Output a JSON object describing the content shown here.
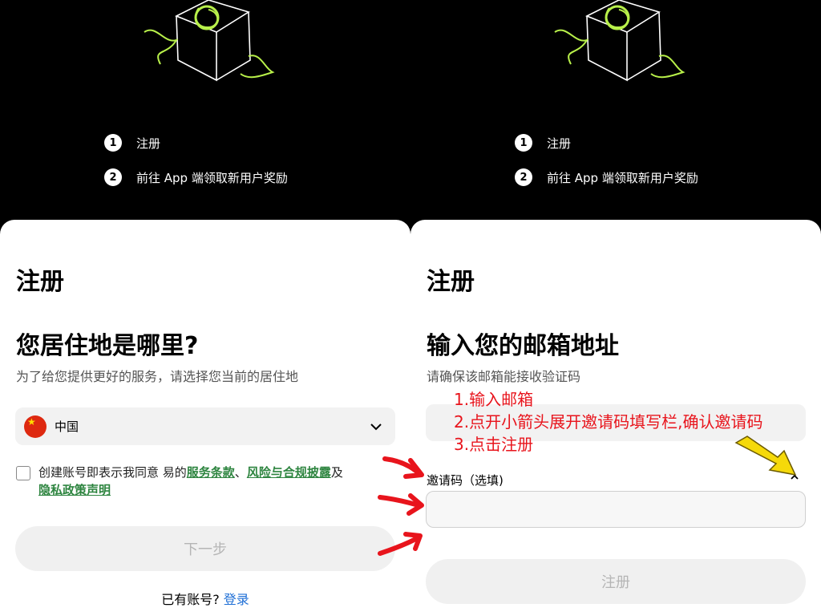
{
  "steps": [
    {
      "num": "1",
      "label": "注册"
    },
    {
      "num": "2",
      "label": "前往 App 端领取新用户奖励"
    }
  ],
  "left": {
    "title": "注册",
    "heading": "您居住地是哪里?",
    "subtitle": "为了给您提供更好的服务，请选择您当前的居住地",
    "country": "中国",
    "agree_prefix": "创建账号即表示我同意    易的",
    "terms_link": "服务条款",
    "sep": "、",
    "risk_link": "风险与合规披露",
    "and": "及",
    "privacy_link": "隐私政策声明",
    "next_button": "下一步",
    "have_account": "已有账号?",
    "login_link": "登录"
  },
  "right": {
    "title": "注册",
    "heading": "输入您的邮箱地址",
    "subtitle": "请确保该邮箱能接收验证码",
    "email_value": "",
    "invite_label": "邀请码（选填)",
    "invite_value": "",
    "register_button": "注册"
  },
  "annotations": [
    "1.输入邮箱",
    "2.点开小箭头展开邀请码填写栏,确认邀请码",
    "3.点击注册"
  ],
  "colors": {
    "accent_green": "#2e8540",
    "login_blue": "#1f6fd6",
    "annotation_red": "#e8141c",
    "annotation_arrow_yellow": "#f5d90a"
  },
  "icons": {
    "country_flag": "china-flag-icon",
    "dropdown": "chevron-down-icon",
    "invite_toggle": "chevron-up-icon"
  }
}
